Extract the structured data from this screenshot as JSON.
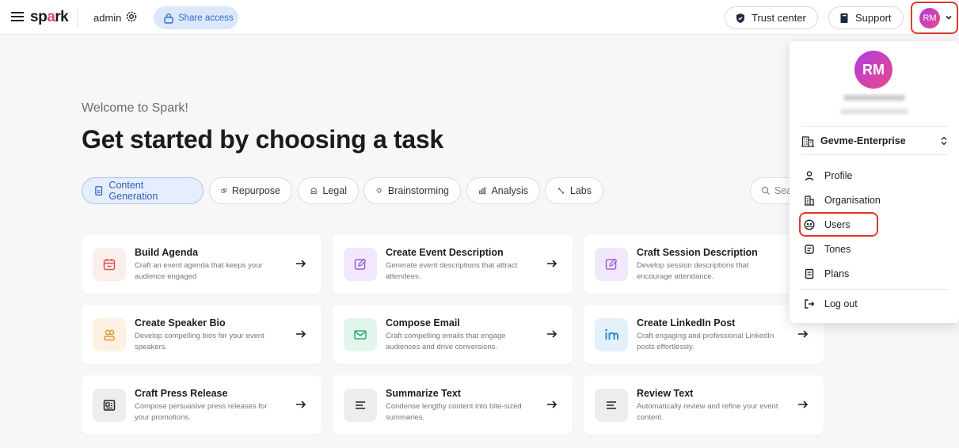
{
  "header": {
    "logo": {
      "pre": "sp",
      "dot": "a",
      "post": "rk"
    },
    "workspace": "admin",
    "share_label": "Share access",
    "trust_label": "Trust center",
    "support_label": "Support",
    "avatar_initials": "RM",
    "accent": "#2f6fcf"
  },
  "main": {
    "welcome": "Welcome to Spark!",
    "headline": "Get started by choosing a task",
    "tabs": [
      {
        "label": "Content Generation",
        "icon": "document-icon",
        "active": true
      },
      {
        "label": "Repurpose",
        "icon": "repurpose-icon"
      },
      {
        "label": "Legal",
        "icon": "building-icon"
      },
      {
        "label": "Brainstorming",
        "icon": "bulb-icon"
      },
      {
        "label": "Analysis",
        "icon": "chart-icon"
      },
      {
        "label": "Labs",
        "icon": "labs-icon"
      }
    ],
    "search_placeholder": "Sea",
    "cards": [
      {
        "title": "Build Agenda",
        "desc": "Craft an event agenda that keeps your audience engaged",
        "icon": "calendar-icon"
      },
      {
        "title": "Create Event Description",
        "desc": "Generate event descriptions that attract attendees.",
        "icon": "edit-icon"
      },
      {
        "title": "Craft Session Description",
        "desc": "Develop session descriptions that encourage attendance.",
        "icon": "edit-icon"
      },
      {
        "title": "Create Speaker Bio",
        "desc": "Develop compelling bios for your event speakers.",
        "icon": "people-icon"
      },
      {
        "title": "Compose Email",
        "desc": "Craft compelling emails that engage audiences and drive conversions.",
        "icon": "mail-icon"
      },
      {
        "title": "Create LinkedIn Post",
        "desc": "Craft engaging and professional LinkedIn posts effortlessly.",
        "icon": "linkedin-icon"
      },
      {
        "title": "Craft Press Release",
        "desc": "Compose persuasive press releases for your promotions.",
        "icon": "press-icon"
      },
      {
        "title": "Summarize Text",
        "desc": "Condense lengthy content into bite-sized summaries.",
        "icon": "lines-icon"
      },
      {
        "title": "Review Text",
        "desc": "Automatically review and refine your event content.",
        "icon": "lines-icon"
      }
    ]
  },
  "account_menu": {
    "initials": "RM",
    "organization": "Gevme-Enterprise",
    "items": [
      {
        "label": "Profile",
        "icon": "person-icon"
      },
      {
        "label": "Organisation",
        "icon": "organisation-icon"
      },
      {
        "label": "Users",
        "icon": "users-icon"
      },
      {
        "label": "Tones",
        "icon": "tones-icon"
      },
      {
        "label": "Plans",
        "icon": "plans-icon"
      }
    ],
    "logout_label": "Log out"
  }
}
